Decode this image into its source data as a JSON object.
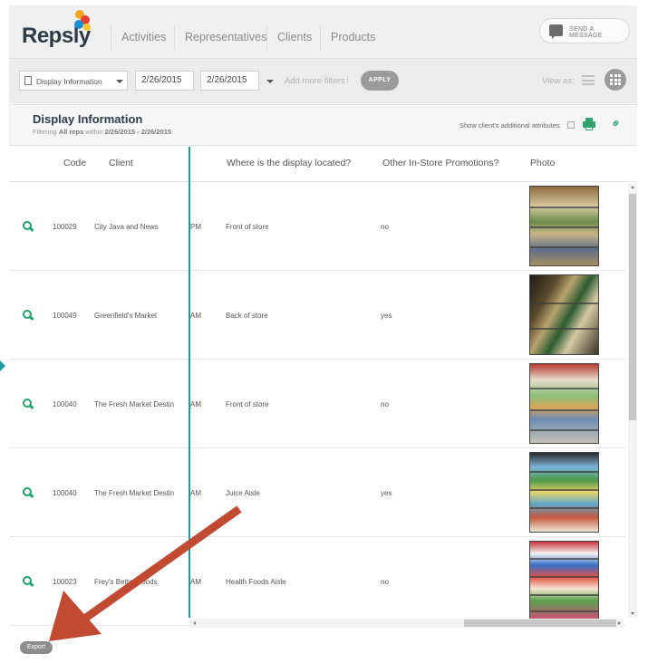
{
  "app": {
    "logo_text": "Repsly",
    "colors": {
      "accent": "#1e9a9a",
      "green": "#1fa36b",
      "annotation_arrow": "#c04a32"
    }
  },
  "nav": {
    "tabs": [
      "Activities",
      "Representatives",
      "Clients",
      "Products"
    ],
    "send_message_label": "SEND A MESSAGE"
  },
  "filters": {
    "form_select": "Display Information",
    "date_from": "2/26/2015",
    "date_to": "2/26/2015",
    "date_separator": "-",
    "more_filters_label": "Add more filters",
    "more_filters_glyph": "⫶",
    "apply_label": "APPLY",
    "view_as_label": "View as:"
  },
  "report": {
    "title": "Display Information",
    "filter_prefix": "Filtering",
    "filter_reps": "All reps",
    "filter_within": "within",
    "filter_range": "2/26/2015 - 2/26/2015",
    "additional_attributes_label": "Show client's additional attributes"
  },
  "table": {
    "columns": [
      "Code",
      "Client",
      "Where is the display located?",
      "Other In-Store Promotions?",
      "Photo"
    ],
    "rows": [
      {
        "code": "100029",
        "client": "City Java and News",
        "time": "PM",
        "location": "Front of store",
        "promotions": "no"
      },
      {
        "code": "100049",
        "client": "Greenfield's Market",
        "time": "AM",
        "location": "Back of store",
        "promotions": "yes"
      },
      {
        "code": "100040",
        "client": "The Fresh Market Destin",
        "time": "AM",
        "location": "Front of store",
        "promotions": "no"
      },
      {
        "code": "100040",
        "client": "The Fresh Market Destin",
        "time": "AM",
        "location": "Juice Aisle",
        "promotions": "yes"
      },
      {
        "code": "100023",
        "client": "Frey's Better Foods",
        "time": "AM",
        "location": "Health Foods Aisle",
        "promotions": "no"
      }
    ]
  },
  "footer": {
    "export_label": "Export"
  }
}
